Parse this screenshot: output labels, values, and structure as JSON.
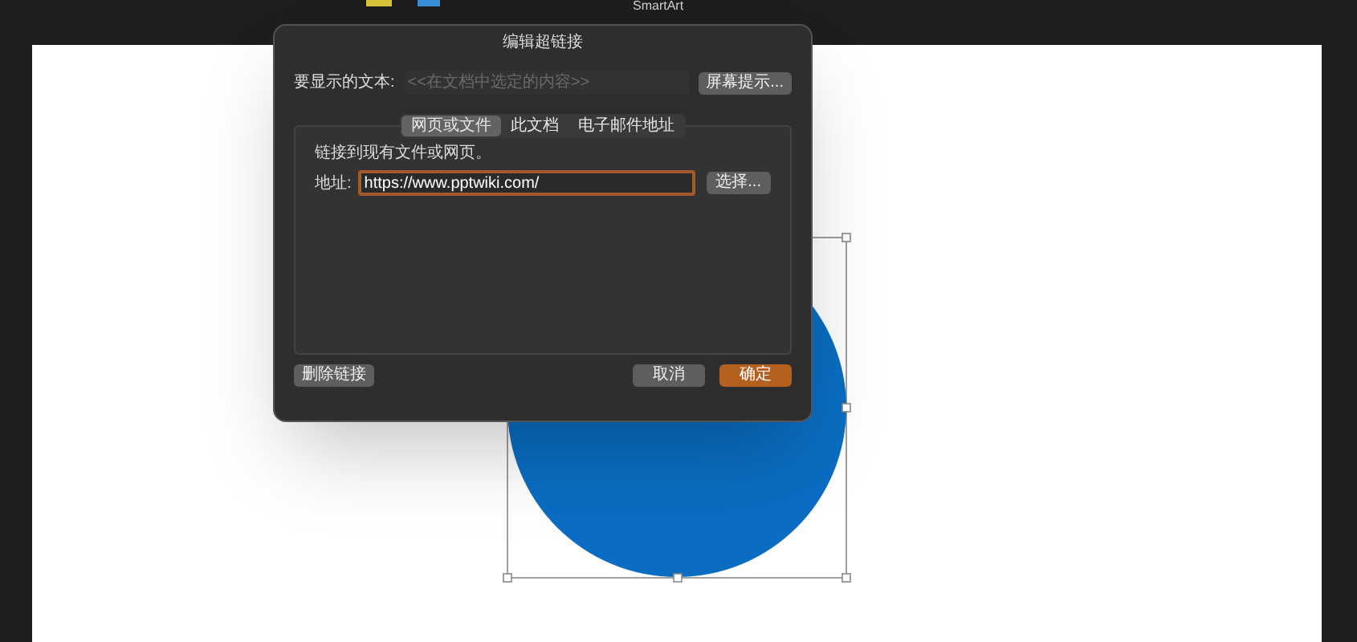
{
  "toolbar": {
    "label": "SmartArt"
  },
  "dialog": {
    "title": "编辑超链接",
    "display_text_label": "要显示的文本:",
    "display_text_placeholder": "<<在文档中选定的内容>>",
    "screen_tip_button": "屏幕提示...",
    "tabs": [
      {
        "label": "网页或文件",
        "selected": true
      },
      {
        "label": "此文档",
        "selected": false
      },
      {
        "label": "电子邮件地址",
        "selected": false
      }
    ],
    "hint": "链接到现有文件或网页。",
    "address_label": "地址:",
    "address_value": "https://www.pptwiki.com/",
    "choose_button": "选择...",
    "remove_button": "删除链接",
    "cancel_button": "取消",
    "ok_button": "确定"
  }
}
